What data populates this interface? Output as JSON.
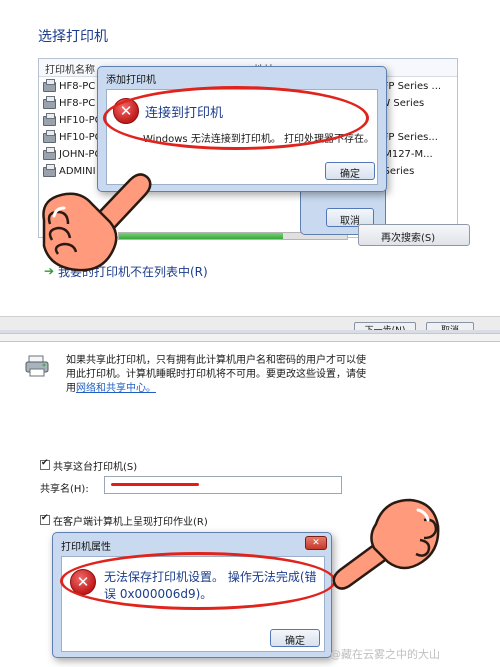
{
  "top": {
    "title": "选择打印机",
    "list": {
      "col_name": "打印机名称",
      "col_address": "地址",
      "rows": [
        {
          "name": "HF8-PC",
          "model": "MFP Series ..."
        },
        {
          "name": "HF8-PC",
          "model": "3W Series"
        },
        {
          "name": "HF10-PC",
          "model": ""
        },
        {
          "name": "HF10-PC",
          "model": "MFP Series..."
        },
        {
          "name": "JOHN-PC",
          "model": "P M127-M..."
        },
        {
          "name": "ADMINI",
          "model": "2 Series"
        }
      ]
    },
    "dialog": {
      "title": "添加打印机",
      "heading": "连接到打印机",
      "message": "Windows 无法连接到打印机。 打印处理器不存在。",
      "ok_label": "确定",
      "cancel_label": "取消"
    },
    "progress_fraction": 0.72,
    "search_again_label": "再次搜索(S)",
    "not_listed_label": "我要的打印机不在列表中(R)",
    "next_label": "下一步(N)",
    "cancel_label": "取消"
  },
  "bottom": {
    "info_text": "如果共享此打印机，只有拥有此计算机用户名和密码的用户才可以使用此打印机。计算机睡眠时打印机将不可用。要更改这些设置，请使用",
    "info_link": "网络和共享中心。",
    "share_label": "共享这台打印机(S)",
    "share_name_label": "共享名(H):",
    "render_label": "在客户端计算机上呈现打印作业(R)",
    "dialog": {
      "title": "打印机属性",
      "message": "无法保存打印机设置。 操作无法完成(错误 0x000006d9)。",
      "ok_label": "确定"
    },
    "watermark": "@藏在云雾之中的大山"
  },
  "colors": {
    "title_blue": "#1c3d8c",
    "annotation_red": "#e0241d",
    "error_red": "#c11a1a",
    "link_blue": "#1f5fc4"
  },
  "icons": {
    "error": "error-x-icon",
    "pointing_hand": "pointing-hand-icon",
    "printer": "printer-icon",
    "shield": "uac-shield-icon"
  }
}
